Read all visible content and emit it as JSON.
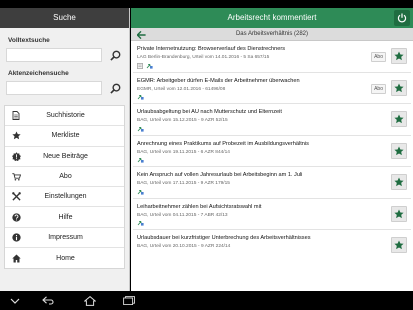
{
  "left": {
    "header_title": "Suche",
    "fulltext_label": "Volltextsuche",
    "fulltext_value": "",
    "docket_label": "Aktenzeichensuche",
    "docket_value": "",
    "menu": [
      {
        "label": "Suchhistorie",
        "icon": "document-icon"
      },
      {
        "label": "Merkliste",
        "icon": "star-icon"
      },
      {
        "label": "Neue Beiträge",
        "icon": "alert-icon"
      },
      {
        "label": "Abo",
        "icon": "cart-icon"
      },
      {
        "label": "Einstellungen",
        "icon": "tools-icon"
      },
      {
        "label": "Hilfe",
        "icon": "help-icon"
      },
      {
        "label": "Impressum",
        "icon": "info-icon"
      },
      {
        "label": "Home",
        "icon": "home-icon"
      }
    ]
  },
  "right": {
    "header_title": "Arbeitsrecht kommentiert",
    "subbar_title": "Das Arbeitsverhältnis (282)",
    "items": [
      {
        "title": "Private Internetnutzung: Browserverlauf des Dienstrechners",
        "meta": "LAG Berlin-Brandenburg, Urteil vom 14.01.2016 - 5 Sa 657/15",
        "abo": "Abo"
      },
      {
        "title": "EGMR: Arbeitgeber dürfen E-Mails der Arbeitnehmer überwachen",
        "meta": "EGMR, Urteil vom 12.01.2016 - 61496/08",
        "abo": "Abo"
      },
      {
        "title": "Urlaubsabgeltung bei AU nach Mutterschutz und Elternzeit",
        "meta": "BAG, Urteil vom 15.12.2015 - 9 AZR 52/15",
        "abo": ""
      },
      {
        "title": "Anrechnung eines Praktikums auf Probezeit im Ausbildungsverhältnis",
        "meta": "BAG, Urteil vom 19.11.2015 - 6 AZR 844/14",
        "abo": ""
      },
      {
        "title": "Kein Anspruch auf vollen Jahresurlaub bei Arbeitsbeginn am 1. Juli",
        "meta": "BAG, Urteil vom 17.11.2015 - 9 AZR 179/15",
        "abo": ""
      },
      {
        "title": "Leiharbeitnehmer zählen bei Aufsichtsratswahl mit",
        "meta": "BAG, Urteil vom 04.11.2015 - 7 ABR 42/13",
        "abo": ""
      },
      {
        "title": "Urlaubsdauer bei kurzfristiger Unterbrechung des Arbeitsverhältnisses",
        "meta": "BAG, Urteil vom 20.10.2015 - 9 AZR 224/14",
        "abo": ""
      }
    ]
  },
  "colors": {
    "green": "#2e8b57",
    "dark_header": "#3e3e3e",
    "icon_dark": "#333333"
  }
}
